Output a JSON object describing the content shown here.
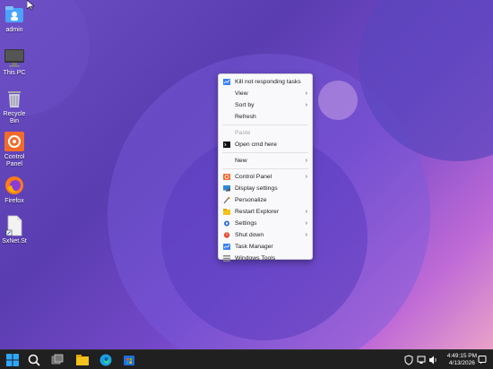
{
  "desktop": {
    "icons": [
      {
        "label": "admin",
        "icon": "user-folder-icon"
      },
      {
        "label": "This PC",
        "icon": "monitor-icon"
      },
      {
        "label": "Recycle Bin",
        "icon": "recycle-bin-icon"
      },
      {
        "label": "Control Panel",
        "icon": "control-panel-icon"
      },
      {
        "label": "Firefox",
        "icon": "firefox-icon"
      },
      {
        "label": "SxNet.St",
        "icon": "file-shortcut-icon"
      }
    ]
  },
  "context_menu": {
    "items": [
      {
        "label": "Kill not responding tasks",
        "icon": "kill-tasks-icon"
      },
      {
        "label": "View",
        "submenu": true
      },
      {
        "label": "Sort by",
        "submenu": true
      },
      {
        "label": "Refresh"
      },
      {
        "label": "Paste",
        "disabled": true
      },
      {
        "label": "Open cmd here",
        "icon": "cmd-icon"
      },
      {
        "label": "New",
        "submenu": true
      },
      {
        "label": "Control Panel",
        "icon": "control-panel-icon",
        "submenu": true
      },
      {
        "label": "Display settings",
        "icon": "display-settings-icon"
      },
      {
        "label": "Personalize",
        "icon": "brush-icon"
      },
      {
        "label": "Restart Explorer",
        "icon": "folder-icon",
        "submenu": true
      },
      {
        "label": "Settings",
        "icon": "settings-gear-icon",
        "submenu": true
      },
      {
        "label": "Shut down",
        "icon": "power-icon",
        "submenu": true
      },
      {
        "label": "Task Manager",
        "icon": "task-manager-icon"
      },
      {
        "label": "Windows Tools",
        "icon": "windows-tools-icon"
      }
    ]
  },
  "taskbar": {
    "clock_time": "4:49:15 PM",
    "clock_date": "4/13/2026",
    "colors": {
      "background": "#202020",
      "accent": "#0078d4"
    }
  }
}
